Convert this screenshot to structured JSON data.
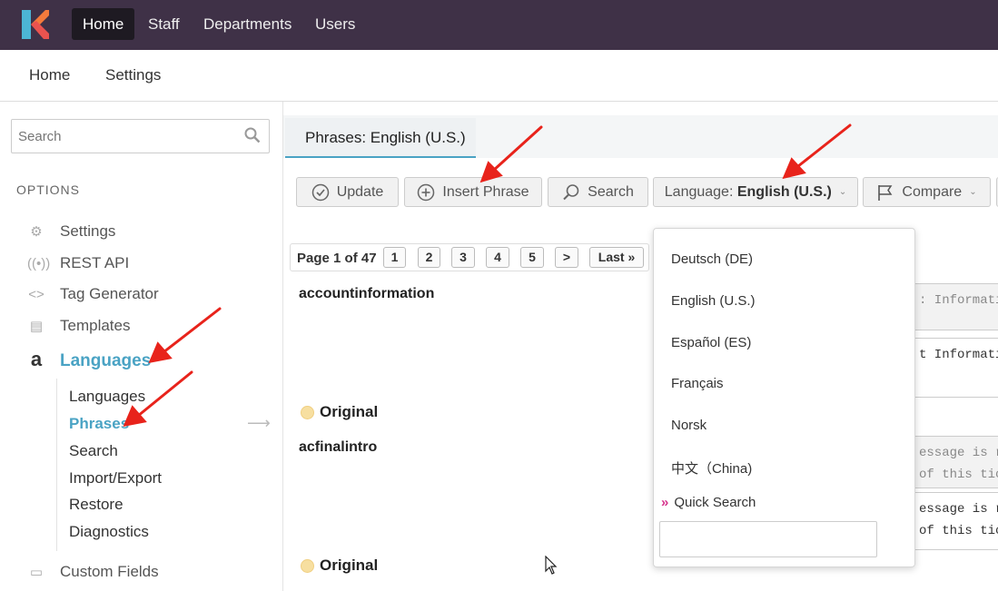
{
  "topnav": {
    "items": [
      "Home",
      "Staff",
      "Departments",
      "Users"
    ],
    "active": "Home"
  },
  "subnav": {
    "items": [
      "Home",
      "Settings"
    ]
  },
  "sidebar": {
    "search_placeholder": "Search",
    "section_heading": "OPTIONS",
    "items": [
      {
        "label": "Settings",
        "icon": "gear-icon"
      },
      {
        "label": "REST API",
        "icon": "broadcast-icon"
      },
      {
        "label": "Tag Generator",
        "icon": "code-icon"
      },
      {
        "label": "Templates",
        "icon": "template-icon"
      },
      {
        "label": "Languages",
        "icon": "language-a-icon"
      },
      {
        "label": "Custom Fields",
        "icon": "form-icon"
      }
    ],
    "sub_items": [
      "Languages",
      "Phrases",
      "Search",
      "Import/Export",
      "Restore",
      "Diagnostics"
    ],
    "current_sub": "Phrases"
  },
  "main": {
    "tab_label": "Phrases: English (U.S.)",
    "toolbar": {
      "update": "Update",
      "insert_phrase": "Insert Phrase",
      "search": "Search",
      "language_prefix": "Language: ",
      "language_value": "English (U.S.)",
      "compare": "Compare"
    },
    "pager": {
      "label": "Page 1 of 47",
      "pages": [
        "1",
        "2",
        "3",
        "4",
        "5"
      ],
      "next": ">",
      "last": "Last »"
    },
    "phrases": [
      {
        "name": "accountinformation",
        "original_label": "Original",
        "code_top": ": Informatio",
        "code_bottom": "t Informatio"
      },
      {
        "name": "acfinalintro",
        "original_label": "Original",
        "code_top_1": "essage is re",
        "code_top_2": "of this tic",
        "code_bottom_1": "essage is re",
        "code_bottom_2": "of this tic"
      }
    ]
  },
  "language_dropdown": {
    "options": [
      "Deutsch (DE)",
      "English (U.S.)",
      "Español (ES)",
      "Français",
      "Norsk",
      "中文（China)"
    ],
    "quick_search_label": "Quick Search"
  }
}
